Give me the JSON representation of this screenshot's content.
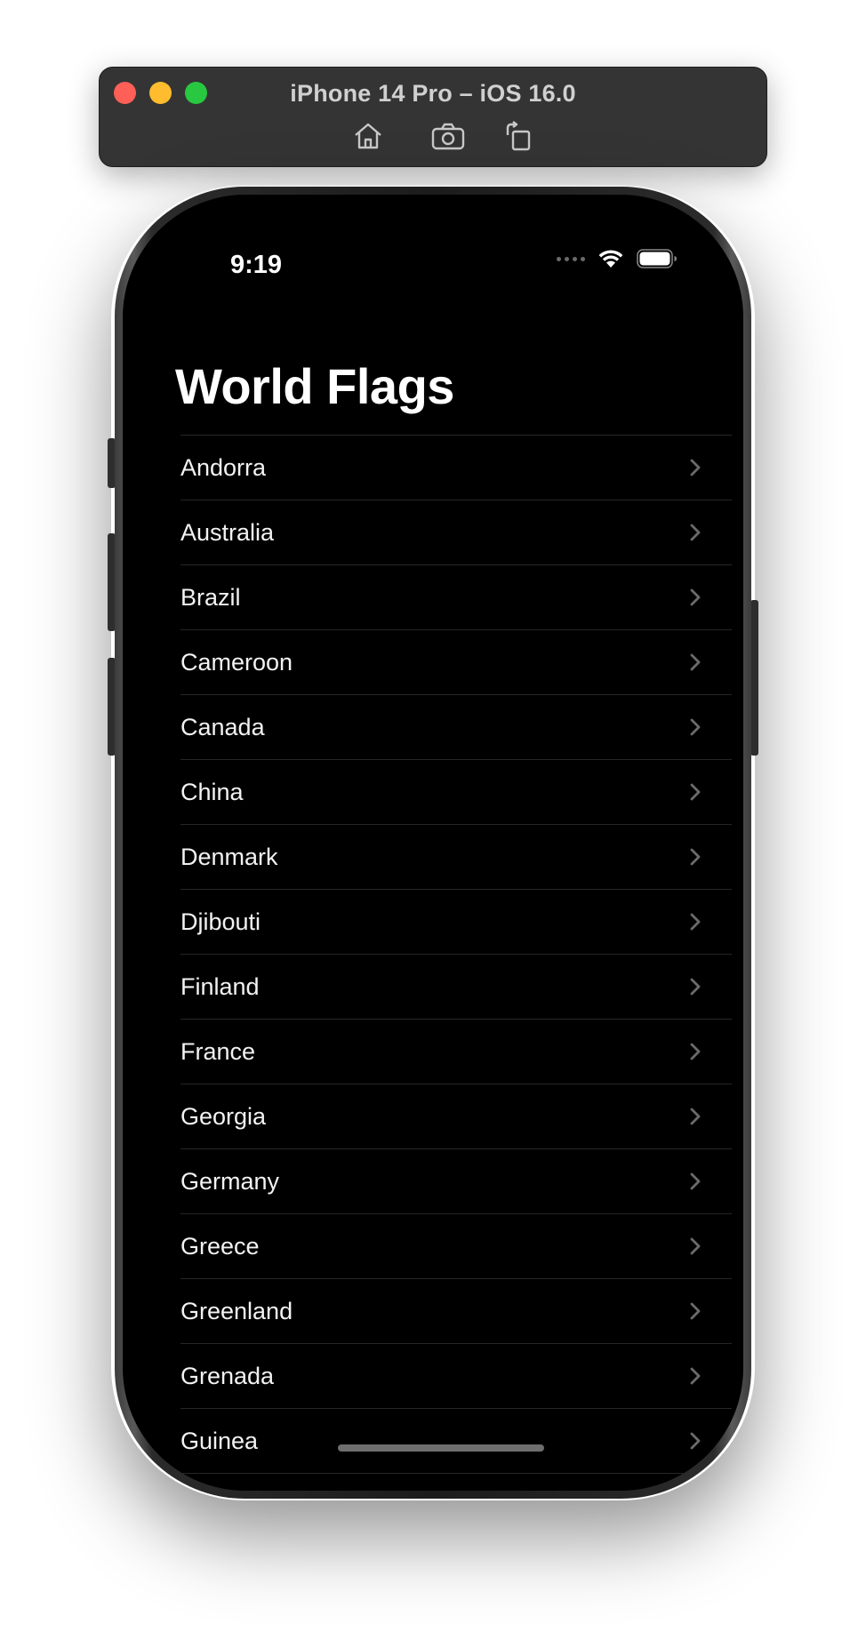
{
  "simulator": {
    "title": "iPhone 14 Pro – iOS 16.0",
    "toolbar_icons": [
      "home-icon",
      "screenshot-icon",
      "rotate-icon"
    ]
  },
  "status_bar": {
    "time": "9:19",
    "icons": [
      "cellular-signal-icon",
      "wifi-icon",
      "battery-icon"
    ]
  },
  "navigation": {
    "title": "World Flags"
  },
  "countries": [
    "Andorra",
    "Australia",
    "Brazil",
    "Cameroon",
    "Canada",
    "China",
    "Denmark",
    "Djibouti",
    "Finland",
    "France",
    "Georgia",
    "Germany",
    "Greece",
    "Greenland",
    "Grenada",
    "Guinea"
  ],
  "row_accessory_icon": "chevron-right-icon",
  "colors": {
    "screen_background": "#000000",
    "text": "#ffffff",
    "separator": "#262626",
    "chevron": "#6b6b6b"
  }
}
